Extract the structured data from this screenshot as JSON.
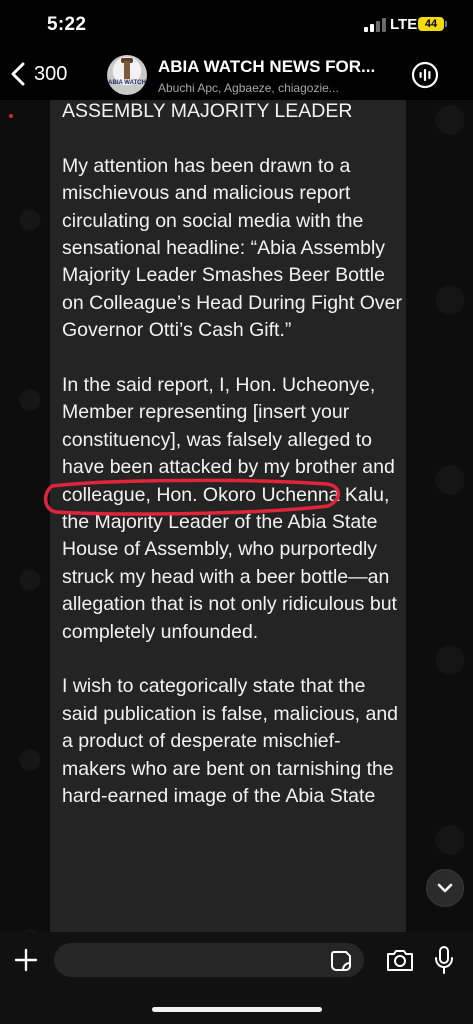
{
  "status_bar": {
    "time": "5:22",
    "network": "LTE",
    "battery": "44",
    "battery_color": "#f5d90a"
  },
  "header": {
    "back_count": "300",
    "avatar_text": "ABIA WATCH",
    "title": "ABIA WATCH NEWS FOR...",
    "subtitle": "Abuchi Apc, Agbaeze, chiagozie..."
  },
  "message": {
    "paragraphs": [
      "ASSEMBLY MAJORITY LEADER",
      "My attention has been drawn to a mischievous and malicious report circulating on social media with the sensational headline: “Abia Assembly Majority Leader Smashes Beer Bottle on Colleague’s Head During Fight Over Governor Otti’s Cash Gift.”",
      "In the said report, I, Hon. Ucheonye, Member representing [insert your constituency], was falsely alleged to have been attacked by my brother and colleague, Hon. Okoro Uchenna Kalu, the Majority Leader of the Abia State House of Assembly, who purportedly struck my head with a beer bottle—an allegation that is not only ridiculous but completely unfounded.",
      "I wish to categorically state that the said publication is false, malicious, and a product of desperate mischief-makers who are bent on tarnishing the hard-earned image of the Abia State"
    ],
    "annotation_color": "#e0243b"
  },
  "input": {
    "placeholder": ""
  }
}
